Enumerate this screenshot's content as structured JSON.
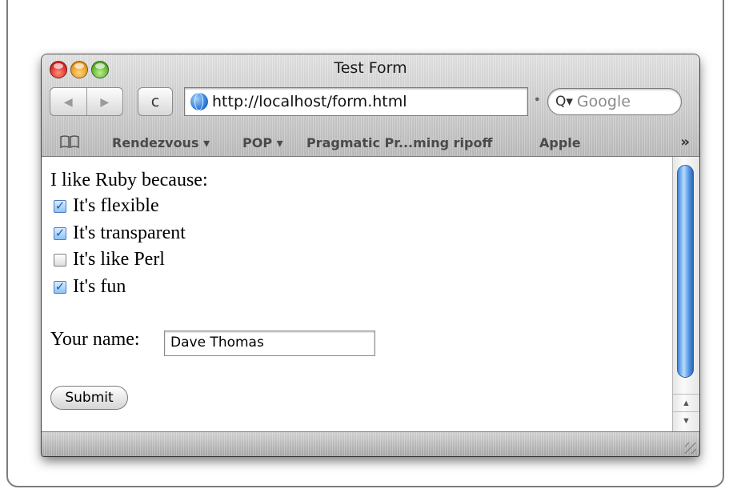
{
  "window": {
    "title": "Test Form"
  },
  "toolbar": {
    "back_icon": "◀",
    "forward_icon": "▶",
    "reload_icon": "c",
    "url": "http://localhost/form.html",
    "search_placeholder": "Google",
    "search_icon": "Q▾"
  },
  "bookmarks": {
    "items": [
      {
        "label": "Rendezvous ▾"
      },
      {
        "label": "POP ▾"
      },
      {
        "label": "Pragmatic Pr...ming ripoff"
      },
      {
        "label": "Apple"
      }
    ],
    "more": "»"
  },
  "form": {
    "question": "I like Ruby because:",
    "options": [
      {
        "label": "It's flexible",
        "checked": true
      },
      {
        "label": "It's transparent",
        "checked": true
      },
      {
        "label": "It's like Perl",
        "checked": false
      },
      {
        "label": "It's fun",
        "checked": true
      }
    ],
    "name_label": "Your name:",
    "name_value": "Dave Thomas",
    "submit_label": "Submit"
  },
  "scrollbar": {
    "up_icon": "▲",
    "down_icon": "▼"
  },
  "colors": {
    "checkbox_accent": "#1e5bb5",
    "scroll_thumb": "#3f86d8"
  }
}
